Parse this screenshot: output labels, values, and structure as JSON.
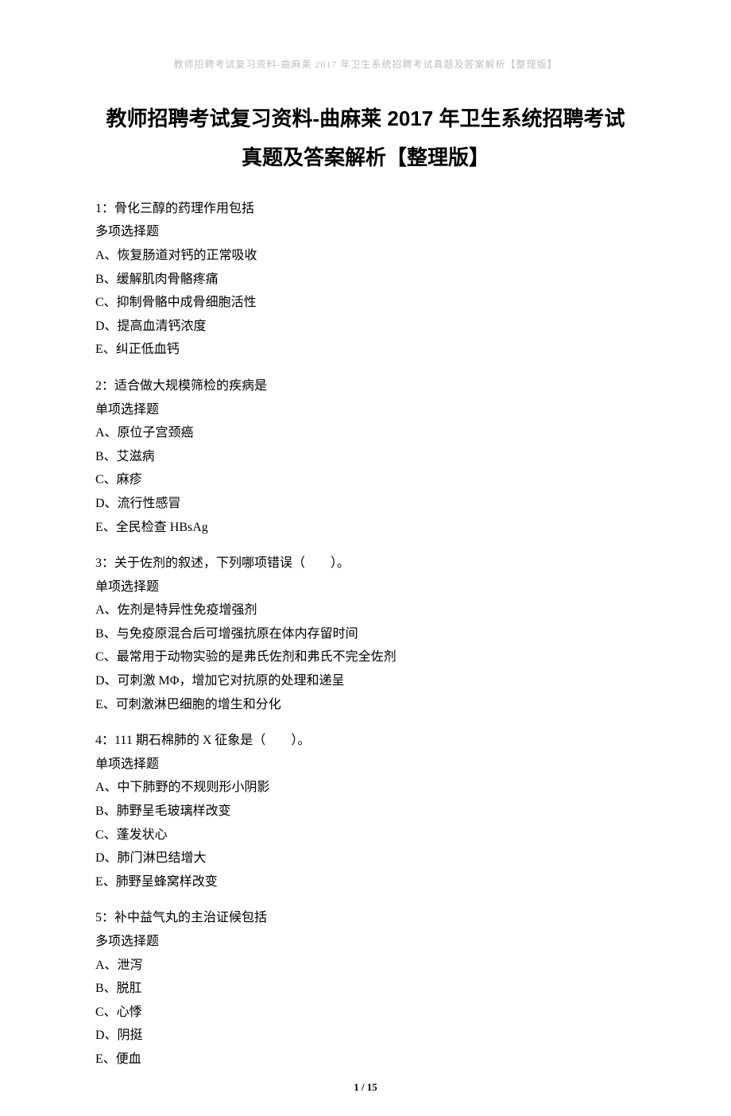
{
  "header": {
    "running": "教师招聘考试复习资料-曲麻莱 2017 年卫生系统招聘考试真题及答案解析【整理版】"
  },
  "title": {
    "line1": "教师招聘考试复习资料-曲麻莱 2017 年卫生系统招聘考试",
    "line2": "真题及答案解析【整理版】"
  },
  "questions": [
    {
      "stem": "1：骨化三醇的药理作用包括",
      "type": "多项选择题",
      "options": [
        "A、恢复肠道对钙的正常吸收",
        "B、缓解肌肉骨骼疼痛",
        "C、抑制骨骼中成骨细胞活性",
        "D、提高血清钙浓度",
        "E、纠正低血钙"
      ]
    },
    {
      "stem": "2：适合做大规模筛检的疾病是",
      "type": "单项选择题",
      "options": [
        "A、原位子宫颈癌",
        "B、艾滋病",
        "C、麻疹",
        "D、流行性感冒",
        "E、全民检查 HBsAg"
      ]
    },
    {
      "stem": "3：关于佐剂的叙述，下列哪项错误（　　）。",
      "type": "单项选择题",
      "options": [
        "A、佐剂是特异性免疫增强剂",
        "B、与免疫原混合后可增强抗原在体内存留时间",
        "C、最常用于动物实验的是弗氏佐剂和弗氏不完全佐剂",
        "D、可刺激 MΦ，增加它对抗原的处理和递呈",
        "E、可刺激淋巴细胞的增生和分化"
      ]
    },
    {
      "stem": "4：111 期石棉肺的 X 征象是（　　）。",
      "type": "单项选择题",
      "options": [
        "A、中下肺野的不规则形小阴影",
        "B、肺野呈毛玻璃样改变",
        "C、蓬发状心",
        "D、肺门淋巴结增大",
        "E、肺野呈蜂窝样改变"
      ]
    },
    {
      "stem": "5：补中益气丸的主治证候包括",
      "type": "多项选择题",
      "options": [
        "A、泄泻",
        "B、脱肛",
        "C、心悸",
        "D、阴挺",
        "E、便血"
      ]
    }
  ],
  "footer": {
    "page_number": "1 / 15"
  }
}
